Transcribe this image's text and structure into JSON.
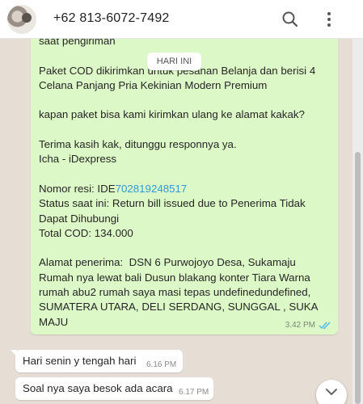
{
  "header": {
    "contact_name": "+62 813-6072-7492",
    "avatar_icon": "contact-photo",
    "search_icon": "search-icon",
    "menu_icon": "kebab-menu-icon"
  },
  "date_chip": "HARI INI",
  "outgoing_message": {
    "lines": [
      "saat pengiriman",
      "",
      "Paket COD dikirimkan untuk pesanan Belanja dan berisi 4",
      "Celana Panjang Pria Kekinian Modern Premium",
      "",
      "kapan paket bisa kami kirimkan ulang ke alamat kakak?",
      "",
      "Terima kasih kak, ditunggu responnya ya.",
      "Icha - iDexpress",
      "",
      "Nomor resi: IDE",
      "Status saat ini: Return bill issued due to Penerima Tidak",
      "Dapat Dihubungi",
      "Total COD: 134.000",
      "",
      "Alamat penerima:  DSN 6 Purwojoyo Desa, Sukamaju",
      "Rumah nya lewat bali Dusun blakang konter Tiara Warna",
      "rumah abu2 rumah saya masi tepas undefinedundefined,",
      "SUMATERA UTARA, DELI SERDANG, SUNGGAL , SUKA",
      "MAJU"
    ],
    "line_1": "saat pengiriman",
    "line_3": "Paket COD dikirimkan untuk pesanan Belanja dan berisi 4",
    "line_4": "Celana Panjang Pria Kekinian Modern Premium",
    "line_6": "kapan paket bisa kami kirimkan ulang ke alamat kakak?",
    "line_8": "Terima kasih kak, ditunggu responnya ya.",
    "line_9": "Icha - iDexpress",
    "resi_prefix": "Nomor resi: IDE",
    "resi_number": "702819248517",
    "line_12": "Status saat ini: Return bill issued due to Penerima Tidak",
    "line_13": "Dapat Dihubungi",
    "line_14": "Total COD: 134.000",
    "line_16": "Alamat penerima:  DSN 6 Purwojoyo Desa, Sukamaju",
    "line_17": "Rumah nya lewat bali Dusun blakang konter Tiara Warna",
    "line_18": "rumah abu2 rumah saya masi tepas undefinedundefined,",
    "line_19": "SUMATERA UTARA, DELI SERDANG, SUNGGAL , SUKA",
    "line_20": "MAJU",
    "time": "3.42 PM",
    "status_icon": "double-check-read-icon"
  },
  "incoming_messages": [
    {
      "text": "Hari senin y tengah hari",
      "time": "6.16 PM"
    },
    {
      "text": "Soal nya saya besok ada acara",
      "time": "6.17 PM"
    }
  ],
  "scroll_button_icon": "chevron-down-icon",
  "colors": {
    "chat_background": "#e6ddd4",
    "outgoing_bubble": "#dcf8c6",
    "incoming_bubble": "#ffffff",
    "link": "#2e9bd6",
    "read_ticks": "#4fb6ec"
  }
}
